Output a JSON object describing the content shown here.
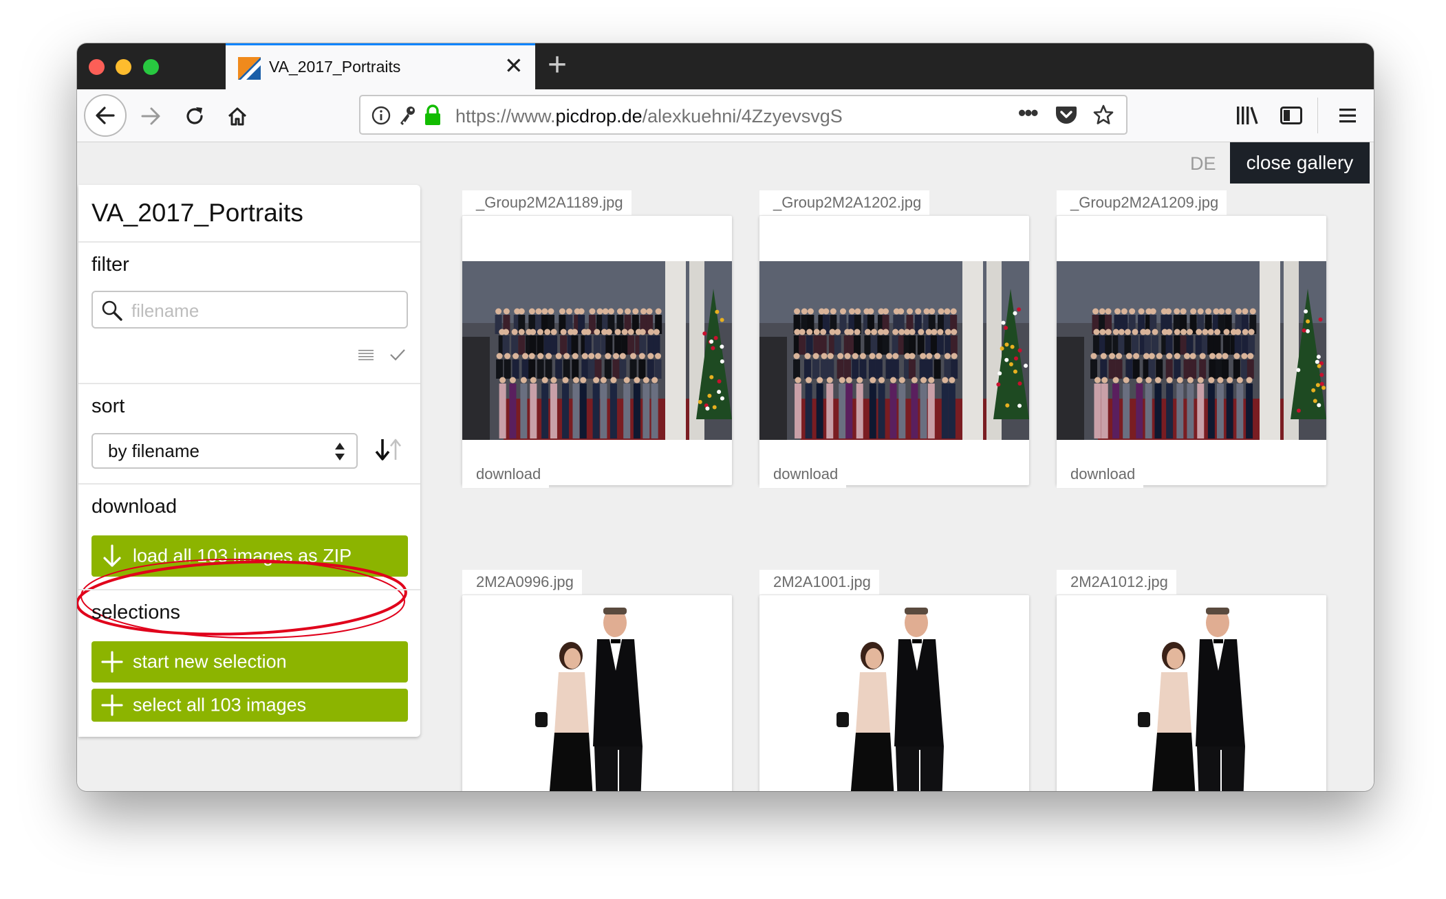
{
  "browser": {
    "tab_title": "VA_2017_Portraits",
    "url_prefix": "https://www.",
    "url_host": "picdrop.de",
    "url_path": "/alexkuehni/4ZzyevsvgS",
    "more_label": "•••"
  },
  "page": {
    "language_toggle": "DE",
    "close_gallery_label": "close gallery"
  },
  "sidebar": {
    "title": "VA_2017_Portraits",
    "filter": {
      "heading": "filter",
      "placeholder": "filename",
      "value": ""
    },
    "sort": {
      "heading": "sort",
      "selected": "by filename"
    },
    "download": {
      "heading": "download",
      "zip_button_label": "load all 103 images as ZIP"
    },
    "selections": {
      "heading": "selections",
      "new_selection_label": "start new selection",
      "select_all_label": "select all 103 images"
    }
  },
  "gallery": {
    "download_label": "download",
    "items": [
      {
        "filename": "_Group2M2A1189.jpg",
        "kind": "group-photo"
      },
      {
        "filename": "_Group2M2A1202.jpg",
        "kind": "group-photo"
      },
      {
        "filename": "_Group2M2A1209.jpg",
        "kind": "group-photo"
      },
      {
        "filename": "2M2A0996.jpg",
        "kind": "couple-photo"
      },
      {
        "filename": "2M2A1001.jpg",
        "kind": "couple-photo"
      },
      {
        "filename": "2M2A1012.jpg",
        "kind": "couple-photo"
      }
    ]
  },
  "colors": {
    "accent_green": "#8cb400",
    "dark_button": "#1c2128",
    "annotation_red": "#e0001b",
    "tab_highlight": "#0a84ff"
  }
}
